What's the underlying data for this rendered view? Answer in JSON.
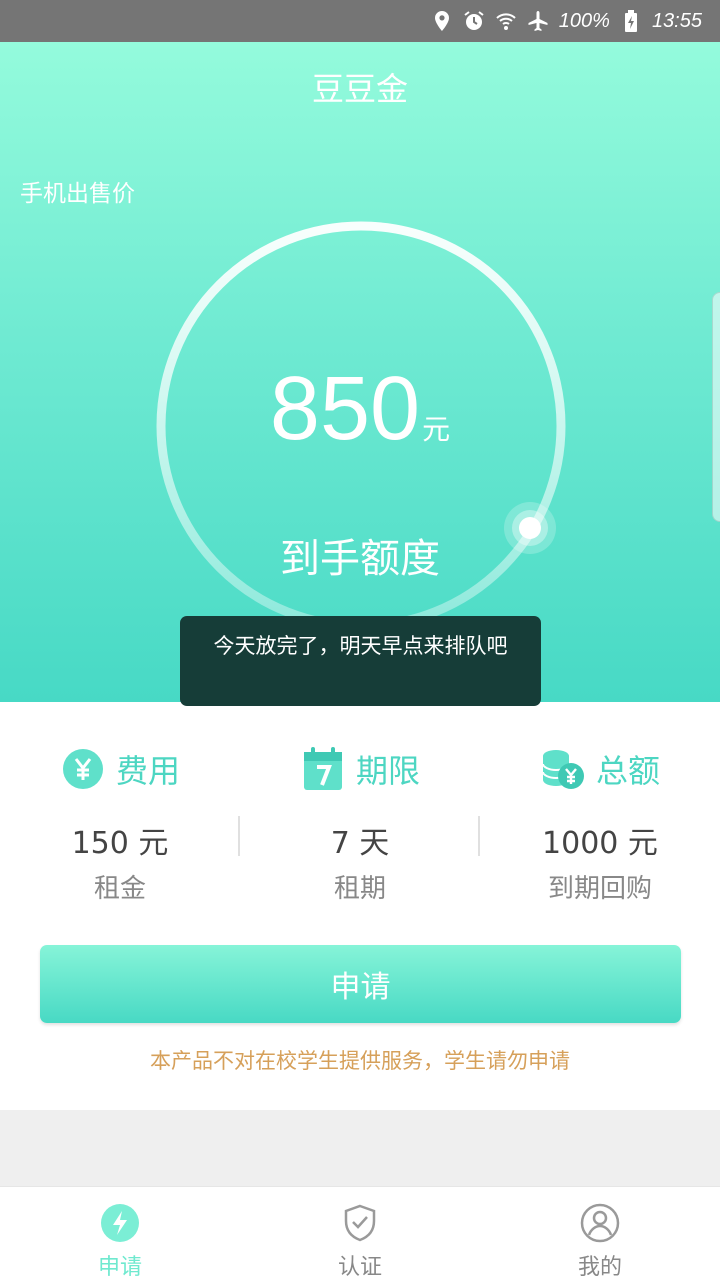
{
  "status_bar": {
    "battery": "100%",
    "time": "13:55"
  },
  "app_title": "豆豆金",
  "hero": {
    "phone_price_label": "手机出售价",
    "amount": "850",
    "amount_unit": "元",
    "amount_label": "到手额度"
  },
  "toast": "今天放完了，明天早点来排队吧",
  "info": [
    {
      "title": "费用",
      "value": "150 元",
      "sub": "租金",
      "icon": "yen-icon"
    },
    {
      "title": "期限",
      "value": "7 天",
      "sub": "租期",
      "icon": "calendar-icon"
    },
    {
      "title": "总额",
      "value": "1000 元",
      "sub": "到期回购",
      "icon": "coins-icon"
    }
  ],
  "apply_button": "申请",
  "notice": "本产品不对在校学生提供服务，学生请勿申请",
  "tabs": [
    {
      "label": "申请",
      "icon": "lightning-icon",
      "active": true
    },
    {
      "label": "认证",
      "icon": "shield-check-icon",
      "active": false
    },
    {
      "label": "我的",
      "icon": "user-icon",
      "active": false
    }
  ],
  "colors": {
    "accent": "#4dd6c2",
    "notice": "#d6a05a",
    "toast_bg": "#163d38"
  }
}
